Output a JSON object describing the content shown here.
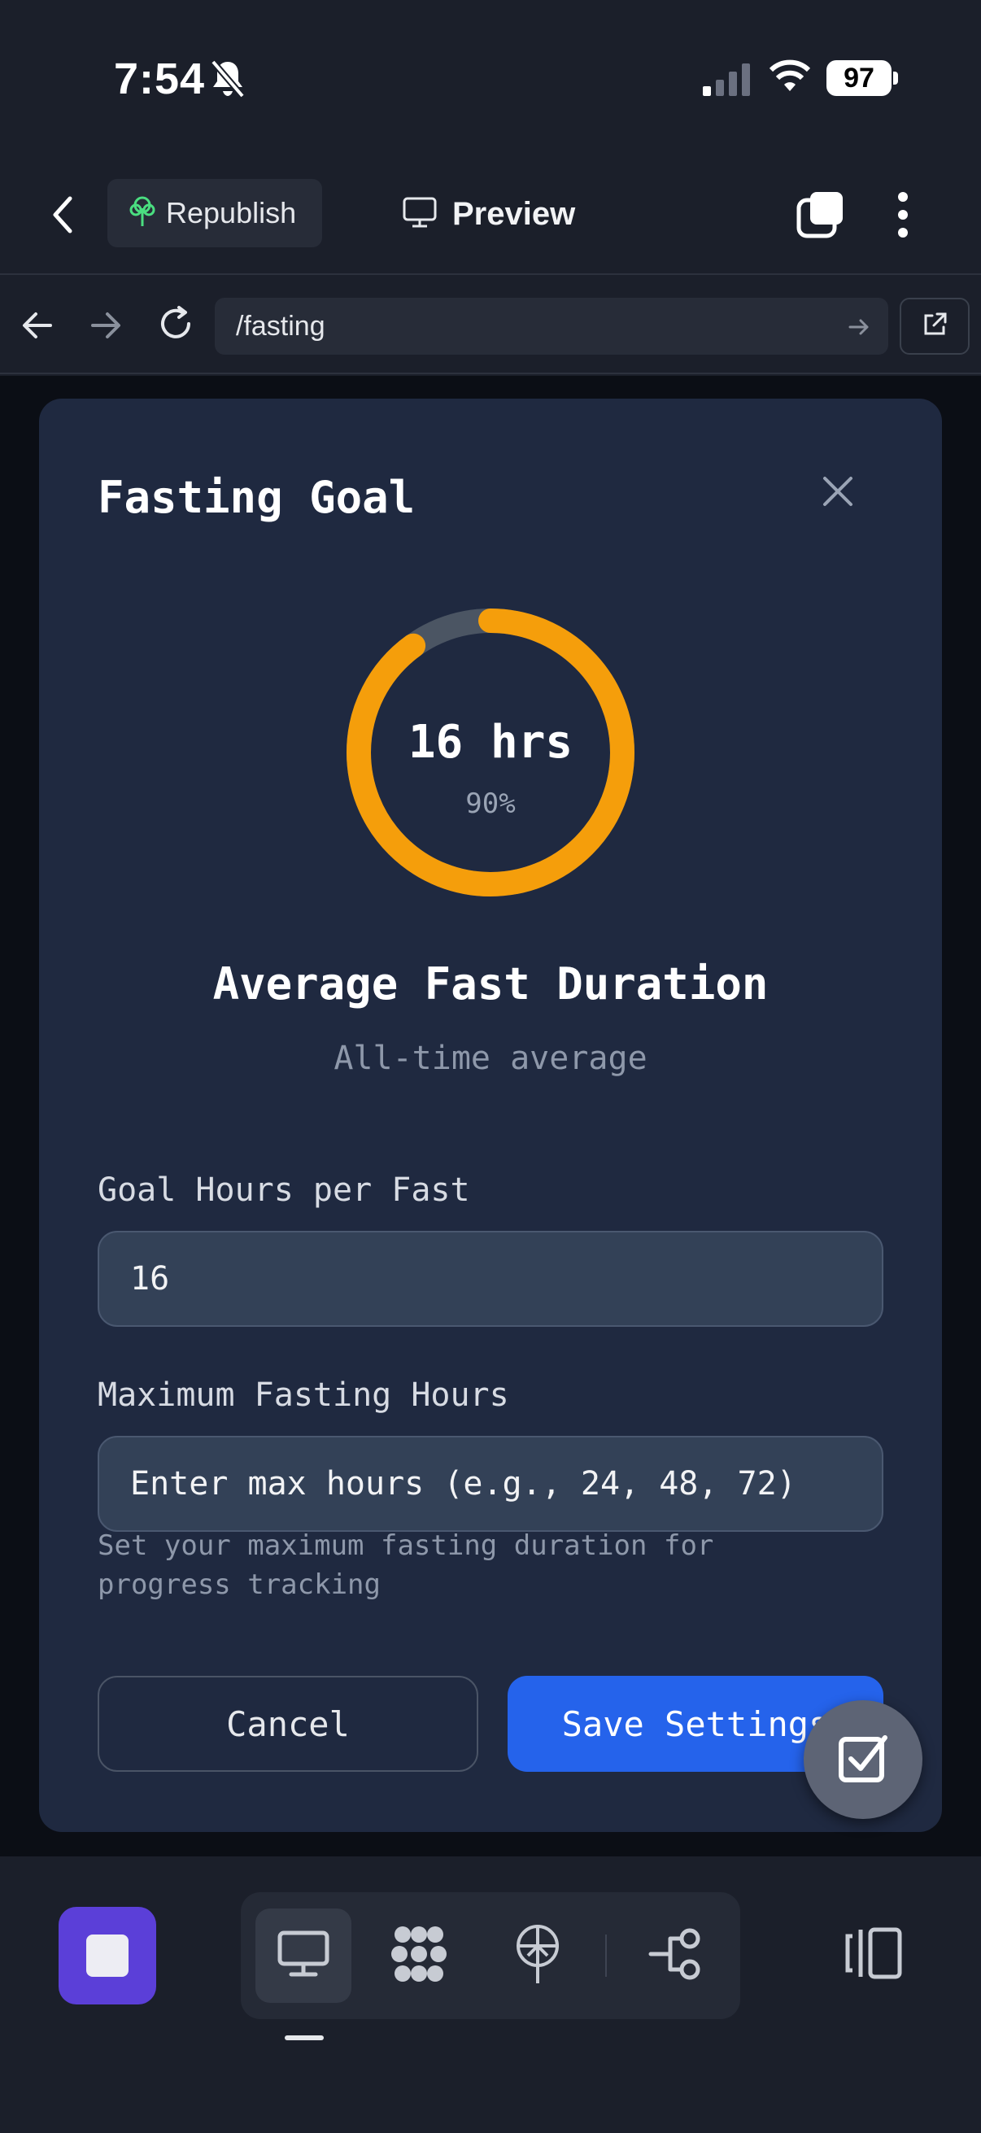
{
  "status_bar": {
    "time": "7:54",
    "battery": "97"
  },
  "toolbar": {
    "republish_label": "Republish",
    "preview_label": "Preview"
  },
  "url_bar": {
    "path": "/fasting"
  },
  "modal": {
    "title": "Fasting Goal",
    "ring": {
      "hours_label": "16 hrs",
      "percent_label": "90%",
      "progress": 0.9,
      "progress_color": "#f59e0b",
      "track_color": "#4b5563"
    },
    "section_title": "Average Fast Duration",
    "section_subtitle": "All-time average",
    "goal_field": {
      "label": "Goal Hours per Fast",
      "value": "16"
    },
    "max_field": {
      "label": "Maximum Fasting Hours",
      "placeholder": "Enter max hours (e.g., 24, 48, 72)",
      "help": "Set your maximum fasting duration for progress tracking"
    },
    "cancel_label": "Cancel",
    "save_label": "Save Settings"
  },
  "colors": {
    "accent_blue": "#2563eb",
    "app_tile": "#5b3fd8",
    "card_bg": "#1f2940"
  },
  "bottom_bar": {
    "icons": [
      "desktop-icon",
      "apps-grid-icon",
      "deploy-icon",
      "integrations-icon",
      "side-panel-icon"
    ],
    "active_tool": "desktop-icon"
  }
}
